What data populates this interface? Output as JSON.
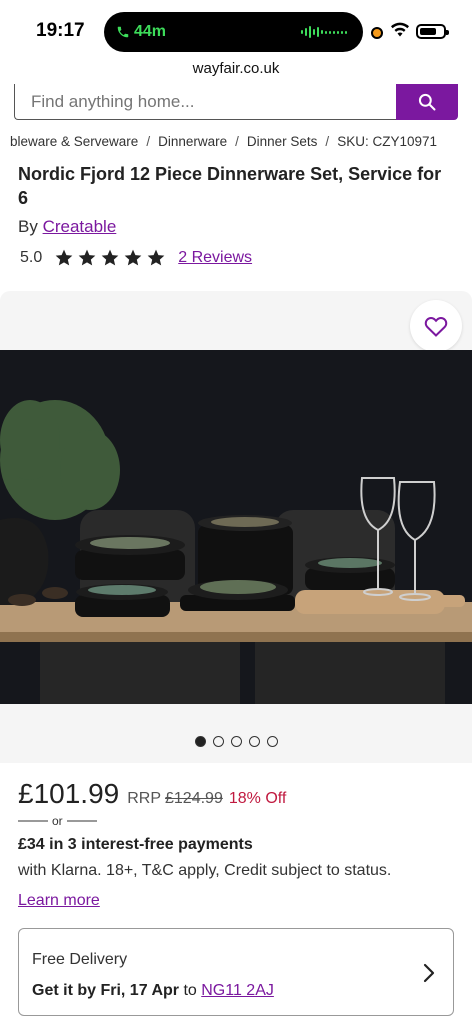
{
  "status_bar": {
    "time": "19:17",
    "call_duration": "44m"
  },
  "browser": {
    "url": "wayfair.co.uk"
  },
  "search": {
    "placeholder": "Find anything home..."
  },
  "breadcrumb": {
    "items": [
      "bleware & Serveware",
      "Dinnerware",
      "Dinner Sets"
    ],
    "sku": "SKU: CZY10971"
  },
  "product": {
    "title": "Nordic Fjord 12 Piece Dinnerware Set, Service for 6",
    "brand_prefix": "By",
    "brand": "Creatable",
    "rating": "5.0",
    "star_count": 5,
    "reviews_label": "2 Reviews"
  },
  "gallery": {
    "image_count": 5,
    "active_index": 0
  },
  "pricing": {
    "price": "£101.99",
    "rrp_label": "RRP",
    "rrp_value": "£124.99",
    "discount": "18% Off",
    "or_label": "or",
    "klarna_title": "£34 in 3 interest-free payments",
    "klarna_desc": "with Klarna. 18+, T&C apply, Credit subject to status.",
    "learn_more": "Learn more"
  },
  "delivery": {
    "title": "Free Delivery",
    "get_it_by": "Get it by Fri, 17 Apr",
    "to_label": "to",
    "postcode": "NG11 2AJ"
  },
  "colors": {
    "brand_purple": "#7b189f",
    "discount_red": "#c0193f"
  }
}
